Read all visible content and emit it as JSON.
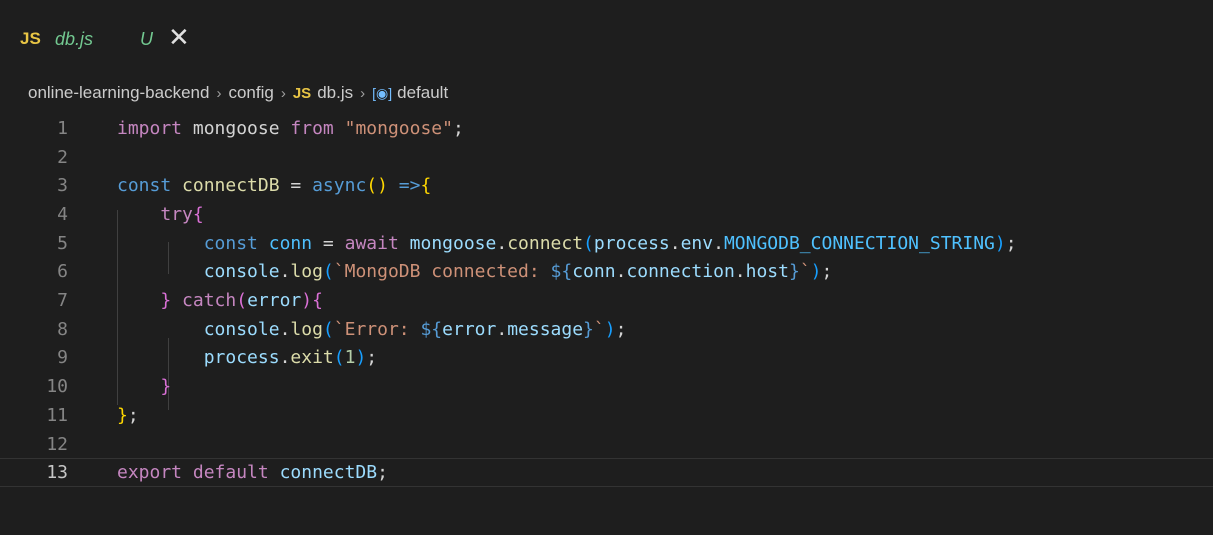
{
  "tab": {
    "icon_label": "JS",
    "filename": "db.js",
    "status": "U",
    "close": "✕"
  },
  "breadcrumb": {
    "items": [
      "online-learning-backend",
      "config",
      "db.js",
      "default"
    ],
    "js_label": "JS",
    "symbol_icon": "[◉]",
    "separator": "›"
  },
  "editor": {
    "active_line": 13,
    "lines": [
      {
        "n": "1",
        "tokens": [
          [
            "import",
            "k-kw"
          ],
          [
            " mongoose ",
            "k-pun"
          ],
          [
            "from",
            "k-kw"
          ],
          [
            " ",
            "k-pun"
          ],
          [
            "\"mongoose\"",
            "k-str"
          ],
          [
            ";",
            "k-pun"
          ]
        ]
      },
      {
        "n": "2",
        "tokens": []
      },
      {
        "n": "3",
        "tokens": [
          [
            "const",
            "k-decl"
          ],
          [
            " ",
            "k-pun"
          ],
          [
            "connectDB",
            "k-fn"
          ],
          [
            " = ",
            "k-pun"
          ],
          [
            "async",
            "k-decl"
          ],
          [
            "()",
            "k-br1"
          ],
          [
            " =>",
            "k-decl"
          ],
          [
            "{",
            "k-br1"
          ]
        ]
      },
      {
        "n": "4",
        "tokens": [
          [
            "    ",
            "k-pun"
          ],
          [
            "try",
            "k-kw"
          ],
          [
            "{",
            "k-br2"
          ]
        ]
      },
      {
        "n": "5",
        "tokens": [
          [
            "        ",
            "k-pun"
          ],
          [
            "const",
            "k-decl"
          ],
          [
            " ",
            "k-pun"
          ],
          [
            "conn",
            "k-const"
          ],
          [
            " = ",
            "k-pun"
          ],
          [
            "await",
            "k-kw"
          ],
          [
            " ",
            "k-pun"
          ],
          [
            "mongoose",
            "k-var"
          ],
          [
            ".",
            "k-pun"
          ],
          [
            "connect",
            "k-fn"
          ],
          [
            "(",
            "k-br3"
          ],
          [
            "process",
            "k-var"
          ],
          [
            ".",
            "k-pun"
          ],
          [
            "env",
            "k-var"
          ],
          [
            ".",
            "k-pun"
          ],
          [
            "MONGODB_CONNECTION_STRING",
            "k-const"
          ],
          [
            ")",
            "k-br3"
          ],
          [
            ";",
            "k-pun"
          ]
        ]
      },
      {
        "n": "6",
        "tokens": [
          [
            "        ",
            "k-pun"
          ],
          [
            "console",
            "k-var"
          ],
          [
            ".",
            "k-pun"
          ],
          [
            "log",
            "k-fn"
          ],
          [
            "(",
            "k-br3"
          ],
          [
            "`MongoDB connected: ",
            "k-str"
          ],
          [
            "${",
            "k-decl"
          ],
          [
            "conn",
            "k-var"
          ],
          [
            ".",
            "k-pun"
          ],
          [
            "connection",
            "k-var"
          ],
          [
            ".",
            "k-pun"
          ],
          [
            "host",
            "k-var"
          ],
          [
            "}",
            "k-decl"
          ],
          [
            "`",
            "k-str"
          ],
          [
            ")",
            "k-br3"
          ],
          [
            ";",
            "k-pun"
          ]
        ]
      },
      {
        "n": "7",
        "tokens": [
          [
            "    ",
            "k-pun"
          ],
          [
            "}",
            "k-br2"
          ],
          [
            " ",
            "k-pun"
          ],
          [
            "catch",
            "k-kw"
          ],
          [
            "(",
            "k-br2"
          ],
          [
            "error",
            "k-var"
          ],
          [
            ")",
            "k-br2"
          ],
          [
            "{",
            "k-br2"
          ]
        ]
      },
      {
        "n": "8",
        "tokens": [
          [
            "        ",
            "k-pun"
          ],
          [
            "console",
            "k-var"
          ],
          [
            ".",
            "k-pun"
          ],
          [
            "log",
            "k-fn"
          ],
          [
            "(",
            "k-br3"
          ],
          [
            "`Error: ",
            "k-str"
          ],
          [
            "${",
            "k-decl"
          ],
          [
            "error",
            "k-var"
          ],
          [
            ".",
            "k-pun"
          ],
          [
            "message",
            "k-var"
          ],
          [
            "}",
            "k-decl"
          ],
          [
            "`",
            "k-str"
          ],
          [
            ")",
            "k-br3"
          ],
          [
            ";",
            "k-pun"
          ]
        ]
      },
      {
        "n": "9",
        "tokens": [
          [
            "        ",
            "k-pun"
          ],
          [
            "process",
            "k-var"
          ],
          [
            ".",
            "k-pun"
          ],
          [
            "exit",
            "k-fn"
          ],
          [
            "(",
            "k-br3"
          ],
          [
            "1",
            "k-num"
          ],
          [
            ")",
            "k-br3"
          ],
          [
            ";",
            "k-pun"
          ]
        ]
      },
      {
        "n": "10",
        "tokens": [
          [
            "    ",
            "k-pun"
          ],
          [
            "}",
            "k-br2"
          ]
        ]
      },
      {
        "n": "11",
        "tokens": [
          [
            "}",
            "k-br1"
          ],
          [
            ";",
            "k-pun"
          ]
        ]
      },
      {
        "n": "12",
        "tokens": []
      },
      {
        "n": "13",
        "tokens": [
          [
            "export",
            "k-kw"
          ],
          [
            " ",
            "k-pun"
          ],
          [
            "default",
            "k-kw"
          ],
          [
            " ",
            "k-pun"
          ],
          [
            "connectDB",
            "k-var"
          ],
          [
            ";",
            "k-pun"
          ]
        ]
      }
    ]
  }
}
